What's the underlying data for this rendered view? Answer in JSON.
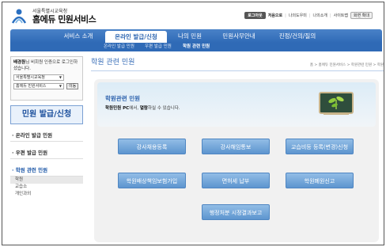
{
  "header": {
    "org": "서울특별시교육청",
    "title": "홈에듀 민원서비스",
    "util": {
      "logout": "로그아웃",
      "first_page": "처음으로",
      "my_service": "나의도우미",
      "intro": "나의소개",
      "sitemap": "사이트맵",
      "font_label": "화면 확대"
    }
  },
  "nav": {
    "items": [
      "서비스 소개",
      "온라인 발급/신청",
      "나의 민원",
      "민원사무안내",
      "진정/건의/질의"
    ],
    "sub": [
      "온라인 발급 민원",
      "우편 발급 민원",
      "학원 관련 민원"
    ]
  },
  "sidebar": {
    "login_msg_name": "배경원",
    "login_msg_rest": "님 비회원 인증으로 로그인하셨습니다.",
    "select_region": "서울특별시교육청",
    "select_dept": "홈에듀 민원서비스",
    "move_btn": "이동",
    "section_title": "민원 발급/신청",
    "menu": [
      "온라인 발급 민원",
      "우편 발급 민원",
      "학원 관련 민원"
    ],
    "submenu": [
      "학원",
      "교습소",
      "개인과외"
    ]
  },
  "content": {
    "page_title": "학원 관련 민원",
    "breadcrumb": "홈 > 홈에듀 민원서비스 > 학원관련 민원 > 학원",
    "panel_title": "학원관련 민원",
    "panel_desc_pre": "학원민원 PC",
    "panel_desc_mid": "에서, ",
    "panel_desc_bold": "열람",
    "panel_desc_post": "하실 수 있습니다.",
    "services": [
      "강사채용등록",
      "강사해임통보",
      "교습비등 등록(변경)신청",
      "학원배상책임보험가입",
      "면허세 납부",
      "학원폐원신고",
      "행정처분 시정결과보고"
    ]
  },
  "colors": {
    "nav": "#2f6ab6",
    "button": "#6fa3d8",
    "title": "#2d62ad"
  }
}
